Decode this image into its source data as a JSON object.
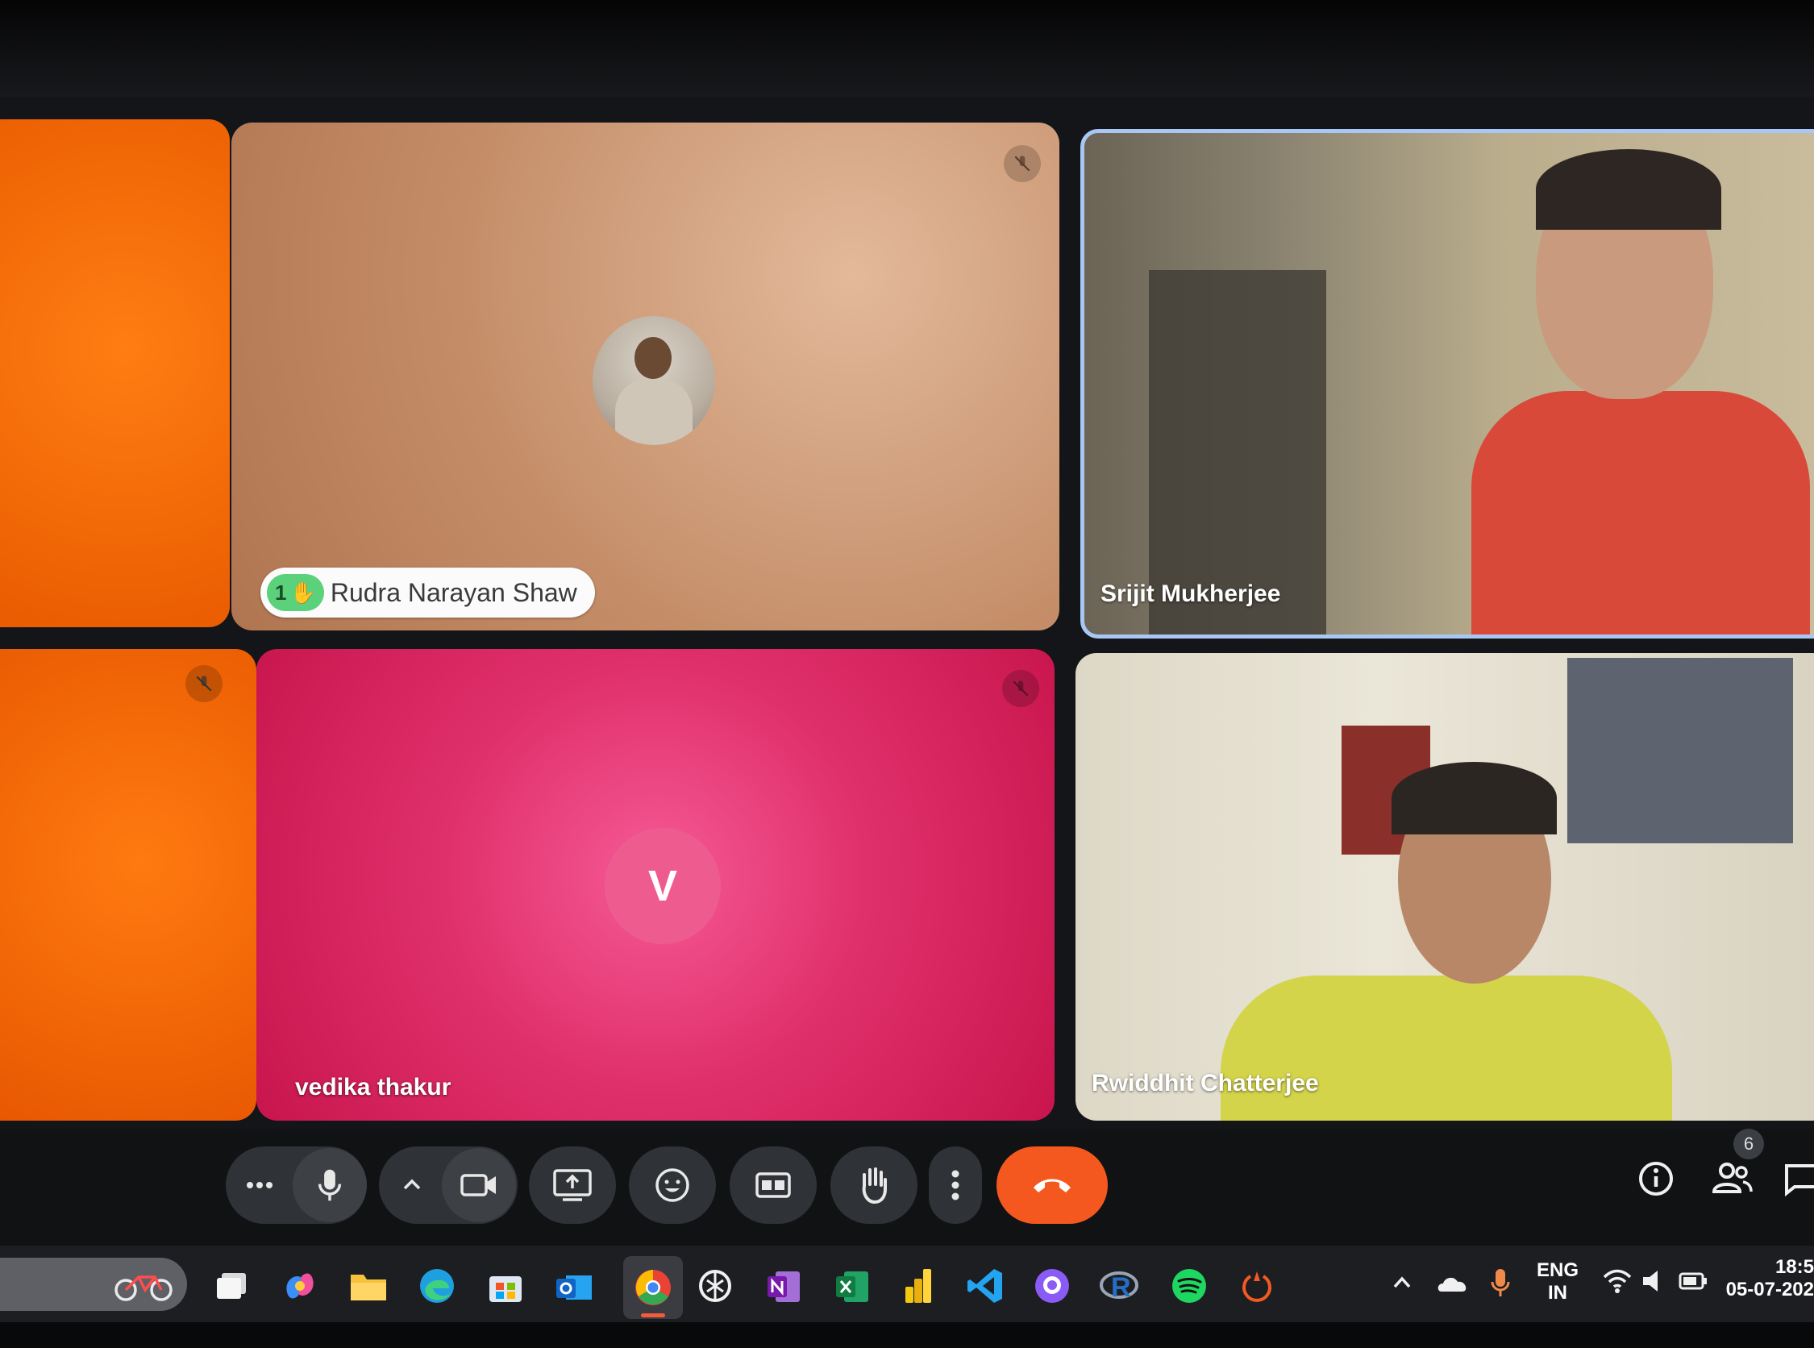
{
  "participants": {
    "rudra": {
      "name": "Rudra Narayan Shaw",
      "hand_count": "1"
    },
    "srijit": {
      "name": "Srijit Mukherjee"
    },
    "vedika": {
      "name": "vedika thakur",
      "initial": "V"
    },
    "rwiddhit": {
      "name": "Rwiddhit Chatterjee"
    }
  },
  "controls": {
    "more": "more-options",
    "mic": "microphone",
    "camera": "camera",
    "present": "present-screen",
    "reactions": "reactions",
    "captions": "captions",
    "raise_hand": "raise-hand",
    "overflow": "more-vertical",
    "end": "end-call"
  },
  "right_controls": {
    "info": "info",
    "people": "people",
    "people_count": "6",
    "chat": "chat"
  },
  "taskbar": {
    "apps": [
      "bike-widget",
      "task-view",
      "copilot",
      "file-explorer",
      "edge",
      "store",
      "outlook",
      "chrome",
      "chatgpt",
      "onenote",
      "excel",
      "power-bi",
      "vscode",
      "github-desktop",
      "rstudio",
      "spotify",
      "power-app"
    ],
    "tray": {
      "lang_top": "ENG",
      "lang_bottom": "IN",
      "time": "18:5",
      "date": "05-07-202"
    }
  },
  "colors": {
    "end_call": "#f4581f",
    "speaker_border": "#a9c7f5",
    "hand_badge": "#5bd17b"
  }
}
